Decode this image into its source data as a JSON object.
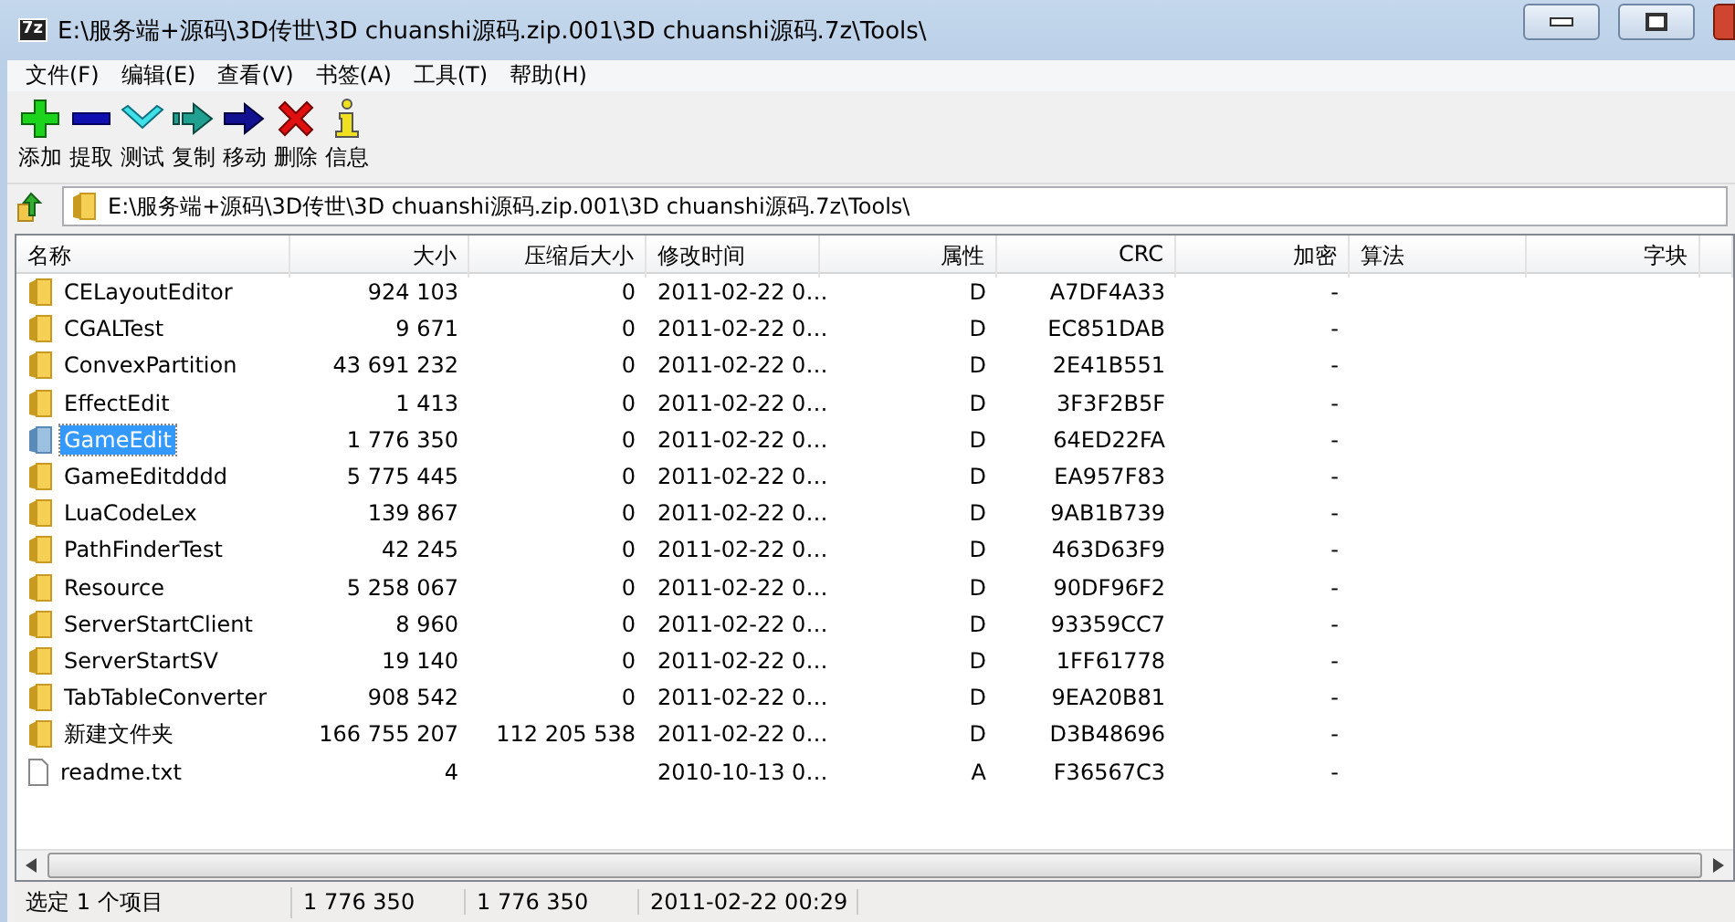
{
  "window": {
    "title": "E:\\服务端+源码\\3D传世\\3D chuanshi源码.zip.001\\3D chuanshi源码.7z\\Tools\\",
    "app_icon": "7z"
  },
  "menu": [
    "文件(F)",
    "编辑(E)",
    "查看(V)",
    "书签(A)",
    "工具(T)",
    "帮助(H)"
  ],
  "toolbar": [
    {
      "label": "添加",
      "kind": "add"
    },
    {
      "label": "提取",
      "kind": "extract"
    },
    {
      "label": "测试",
      "kind": "test"
    },
    {
      "label": "复制",
      "kind": "copy"
    },
    {
      "label": "移动",
      "kind": "move"
    },
    {
      "label": "删除",
      "kind": "delete"
    },
    {
      "label": "信息",
      "kind": "info"
    }
  ],
  "address": {
    "value": "E:\\服务端+源码\\3D传世\\3D chuanshi源码.zip.001\\3D chuanshi源码.7z\\Tools\\"
  },
  "table": {
    "columns": [
      "名称",
      "大小",
      "压缩后大小",
      "修改时间",
      "属性",
      "CRC",
      "加密",
      "算法",
      "字块"
    ],
    "rows": [
      {
        "kind": "folder",
        "selected": false,
        "cells": [
          "CELayoutEditor",
          "924 103",
          "0",
          "2011-02-22 0…",
          "D",
          "A7DF4A33",
          "-"
        ]
      },
      {
        "kind": "folder",
        "selected": false,
        "cells": [
          "CGALTest",
          "9 671",
          "0",
          "2011-02-22 0…",
          "D",
          "EC851DAB",
          "-"
        ]
      },
      {
        "kind": "folder",
        "selected": false,
        "cells": [
          "ConvexPartition",
          "43 691 232",
          "0",
          "2011-02-22 0…",
          "D",
          "2E41B551",
          "-"
        ]
      },
      {
        "kind": "folder",
        "selected": false,
        "cells": [
          "EffectEdit",
          "1 413",
          "0",
          "2011-02-22 0…",
          "D",
          "3F3F2B5F",
          "-"
        ]
      },
      {
        "kind": "folder",
        "selected": true,
        "cells": [
          "GameEdit",
          "1 776 350",
          "0",
          "2011-02-22 0…",
          "D",
          "64ED22FA",
          "-"
        ]
      },
      {
        "kind": "folder",
        "selected": false,
        "cells": [
          "GameEditdddd",
          "5 775 445",
          "0",
          "2011-02-22 0…",
          "D",
          "EA957F83",
          "-"
        ]
      },
      {
        "kind": "folder",
        "selected": false,
        "cells": [
          "LuaCodeLex",
          "139 867",
          "0",
          "2011-02-22 0…",
          "D",
          "9AB1B739",
          "-"
        ]
      },
      {
        "kind": "folder",
        "selected": false,
        "cells": [
          "PathFinderTest",
          "42 245",
          "0",
          "2011-02-22 0…",
          "D",
          "463D63F9",
          "-"
        ]
      },
      {
        "kind": "folder",
        "selected": false,
        "cells": [
          "Resource",
          "5 258 067",
          "0",
          "2011-02-22 0…",
          "D",
          "90DF96F2",
          "-"
        ]
      },
      {
        "kind": "folder",
        "selected": false,
        "cells": [
          "ServerStartClient",
          "8 960",
          "0",
          "2011-02-22 0…",
          "D",
          "93359CC7",
          "-"
        ]
      },
      {
        "kind": "folder",
        "selected": false,
        "cells": [
          "ServerStartSV",
          "19 140",
          "0",
          "2011-02-22 0…",
          "D",
          "1FF61778",
          "-"
        ]
      },
      {
        "kind": "folder",
        "selected": false,
        "cells": [
          "TabTableConverter",
          "908 542",
          "0",
          "2011-02-22 0…",
          "D",
          "9EA20B81",
          "-"
        ]
      },
      {
        "kind": "folder",
        "selected": false,
        "cells": [
          "新建文件夹",
          "166 755 207",
          "112 205 538",
          "2011-02-22 0…",
          "D",
          "D3B48696",
          "-"
        ]
      },
      {
        "kind": "file",
        "selected": false,
        "cells": [
          "readme.txt",
          "4",
          "",
          "2010-10-13 0…",
          "A",
          "F36567C3",
          "-"
        ]
      }
    ]
  },
  "status_bar": [
    "选定 1 个项目",
    "1 776 350",
    "1 776 350",
    "2011-02-22 00:29"
  ]
}
